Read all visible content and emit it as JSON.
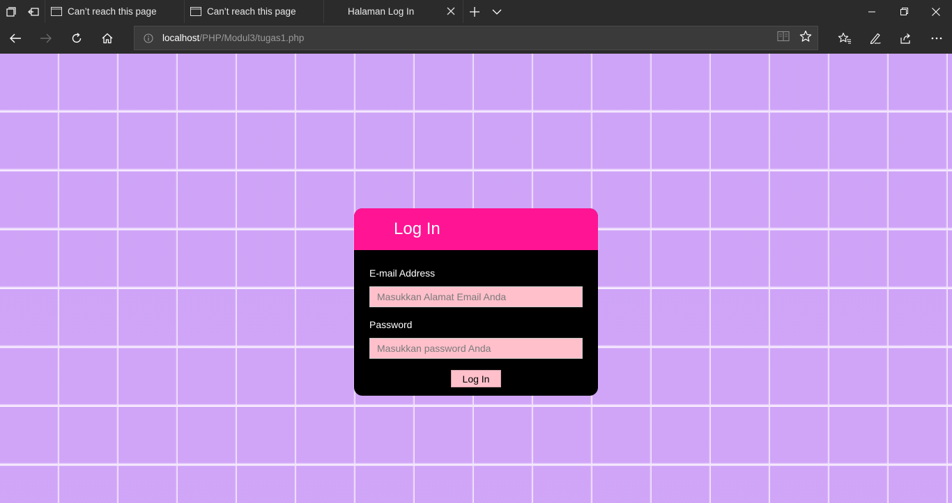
{
  "browser": {
    "tabs": [
      {
        "title": "Can’t reach this page",
        "active": false
      },
      {
        "title": "Can’t reach this page",
        "active": false
      },
      {
        "title": "Halaman Log In",
        "active": true
      }
    ],
    "url": {
      "host": "localhost",
      "path": "/PHP/Modul3/tugas1.php"
    },
    "icons": {
      "tab_sets": "tabs-aside-icon",
      "tab_back": "set-aside-icon",
      "new_tab": "plus-icon",
      "tab_list": "chevron-down-icon",
      "back": "arrow-left-icon",
      "forward": "arrow-right-icon",
      "refresh": "refresh-icon",
      "home": "home-icon",
      "info": "info-icon",
      "reading_view": "book-icon",
      "favorite": "star-icon",
      "favorites_hub": "favorites-icon",
      "notes": "pen-icon",
      "share": "share-icon",
      "more": "more-icon"
    }
  },
  "page": {
    "background_color": "#cfa6f7",
    "login": {
      "title": "Log In",
      "email_label": "E-mail Address",
      "email_placeholder": "Masukkan Alamat Email Anda",
      "password_label": "Password",
      "password_placeholder": "Masukkan password Anda",
      "button_label": "Log In",
      "header_color": "#ff1493",
      "field_color": "#ffc0cb"
    }
  }
}
